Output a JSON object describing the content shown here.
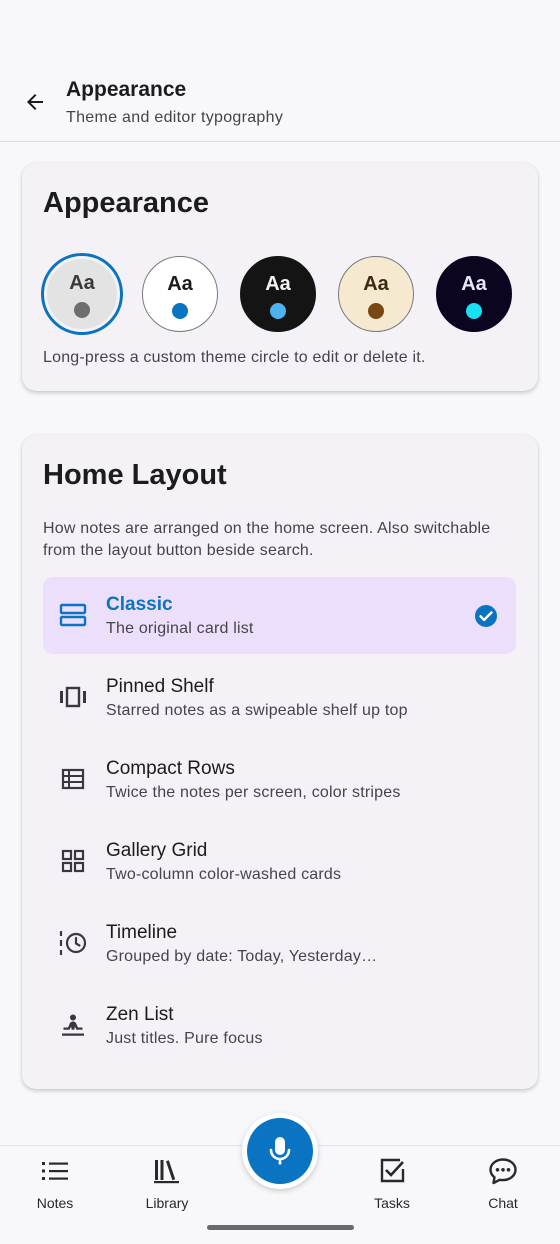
{
  "colors": {
    "accent": "#0a74c2",
    "selected_option_bg": "#ebdffb",
    "card_bg": "#f4f2f7"
  },
  "header": {
    "title": "Appearance",
    "subtitle": "Theme and editor typography",
    "back_icon": "arrow-left-icon"
  },
  "appearance": {
    "title": "Appearance",
    "themes": [
      {
        "label": "Aa",
        "bg": "#e3e3e3",
        "text": "#3a3a3a",
        "dot": "#6e6e6e",
        "border": "#0a74c2",
        "selected": true
      },
      {
        "label": "Aa",
        "bg": "#ffffff",
        "text": "#1c1b1f",
        "dot": "#0a74c2",
        "border": "#7a787e",
        "selected": false
      },
      {
        "label": "Aa",
        "bg": "#141414",
        "text": "#f2f2f2",
        "dot": "#4cb2f0",
        "border": "#141414",
        "selected": false
      },
      {
        "label": "Aa",
        "bg": "#f5e9cf",
        "text": "#3d2a16",
        "dot": "#7a4614",
        "border": "#7a787e",
        "selected": false
      },
      {
        "label": "Aa",
        "bg": "#0b0520",
        "text": "#e8e6f5",
        "dot": "#16e0f2",
        "border": "#0b0520",
        "selected": false
      }
    ],
    "hint": "Long-press a custom theme circle to edit or delete it."
  },
  "home_layout": {
    "title": "Home Layout",
    "description": "How notes are arranged on the home screen. Also switchable from the layout button beside search.",
    "options": [
      {
        "title": "Classic",
        "subtitle": "The original card list",
        "icon": "list-cards-icon",
        "selected": true
      },
      {
        "title": "Pinned Shelf",
        "subtitle": "Starred notes as a swipeable shelf up top",
        "icon": "carousel-icon",
        "selected": false
      },
      {
        "title": "Compact Rows",
        "subtitle": "Twice the notes per screen, color stripes",
        "icon": "rows-icon",
        "selected": false
      },
      {
        "title": "Gallery Grid",
        "subtitle": "Two-column color-washed cards",
        "icon": "grid-icon",
        "selected": false
      },
      {
        "title": "Timeline",
        "subtitle": "Grouped by date: Today, Yesterday…",
        "icon": "timeline-icon",
        "selected": false
      },
      {
        "title": "Zen List",
        "subtitle": "Just titles. Pure focus",
        "icon": "meditation-icon",
        "selected": false
      }
    ]
  },
  "nav": {
    "items": [
      {
        "label": "Notes",
        "icon": "list-icon"
      },
      {
        "label": "Library",
        "icon": "library-icon"
      },
      {
        "label": "Tasks",
        "icon": "checkbox-icon"
      },
      {
        "label": "Chat",
        "icon": "chat-bubble-icon"
      }
    ],
    "fab_icon": "microphone-icon"
  }
}
